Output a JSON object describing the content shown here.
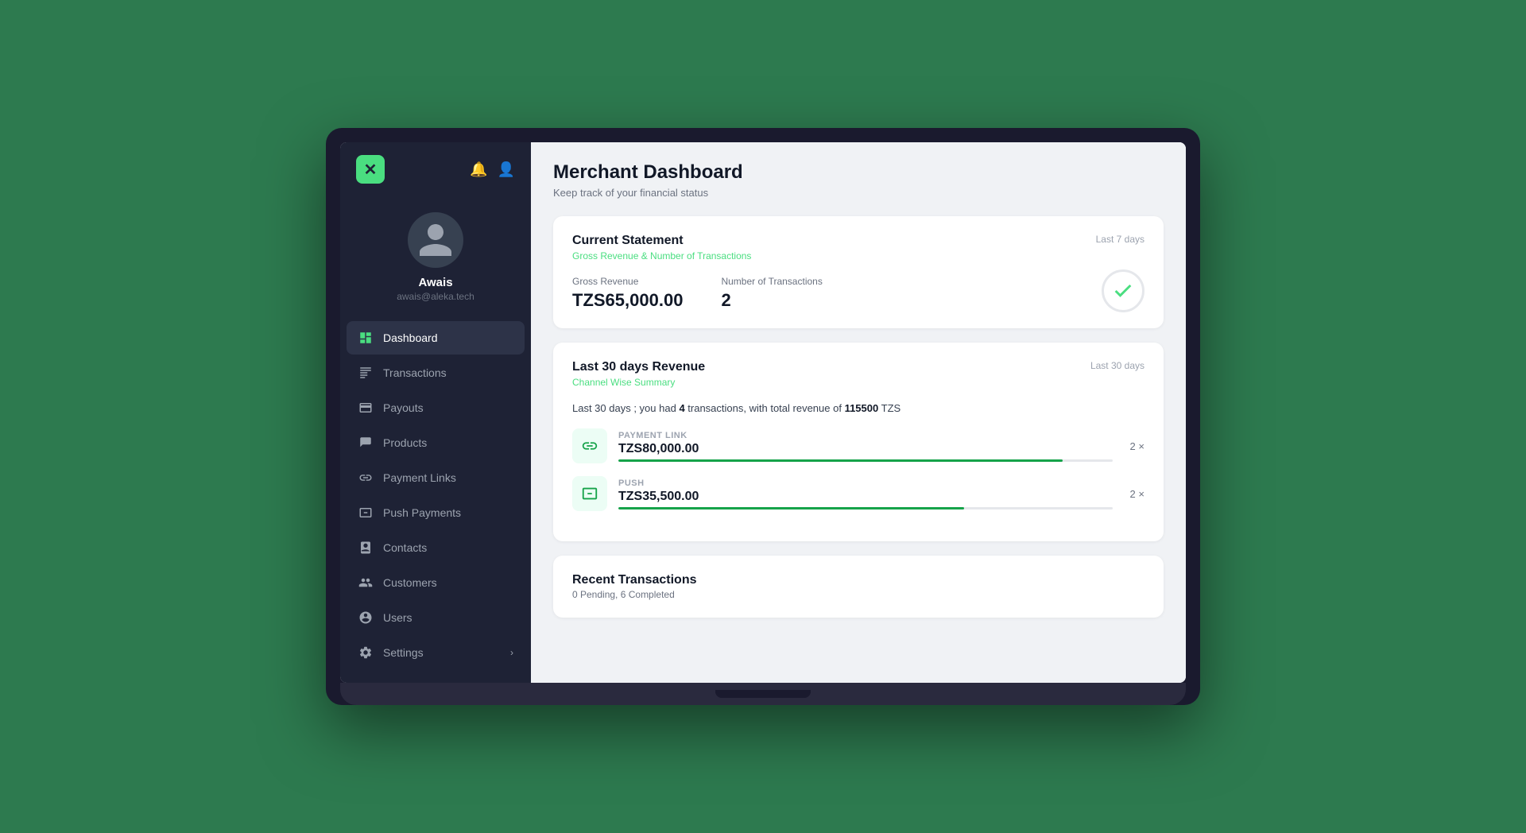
{
  "app": {
    "logo": "✕",
    "notification_icon": "🔔",
    "user_icon": "👤"
  },
  "user": {
    "name": "Awais",
    "email": "awais@aleka.tech"
  },
  "nav": {
    "items": [
      {
        "id": "dashboard",
        "label": "Dashboard",
        "icon": "dashboard",
        "active": true
      },
      {
        "id": "transactions",
        "label": "Transactions",
        "icon": "transactions",
        "active": false
      },
      {
        "id": "payouts",
        "label": "Payouts",
        "icon": "payouts",
        "active": false
      },
      {
        "id": "products",
        "label": "Products",
        "icon": "products",
        "active": false
      },
      {
        "id": "payment-links",
        "label": "Payment Links",
        "icon": "payment-links",
        "active": false
      },
      {
        "id": "push-payments",
        "label": "Push Payments",
        "icon": "push-payments",
        "active": false
      },
      {
        "id": "contacts",
        "label": "Contacts",
        "icon": "contacts",
        "active": false
      },
      {
        "id": "customers",
        "label": "Customers",
        "icon": "customers",
        "active": false
      },
      {
        "id": "users",
        "label": "Users",
        "icon": "users",
        "active": false
      },
      {
        "id": "settings",
        "label": "Settings",
        "icon": "settings",
        "active": false,
        "has_arrow": true
      }
    ]
  },
  "page": {
    "title": "Merchant Dashboard",
    "subtitle": "Keep track of your financial status"
  },
  "current_statement": {
    "title": "Current Statement",
    "subtitle": "Gross Revenue & Number of Transactions",
    "badge": "Last 7 days",
    "gross_revenue_label": "Gross Revenue",
    "gross_revenue_value": "TZS65,000.00",
    "transactions_label": "Number of Transactions",
    "transactions_value": "2"
  },
  "last30": {
    "title": "Last 30 days Revenue",
    "subtitle": "Channel Wise Summary",
    "badge": "Last 30 days",
    "summary_text_prefix": "Last 30 days ; you had ",
    "transactions_count": "4",
    "summary_text_middle": " transactions, with total revenue of ",
    "total_revenue": "115500",
    "currency": "TZS",
    "channels": [
      {
        "label": "PAYMENT LINK",
        "amount": "TZS80,000.00",
        "bar_percent": 90,
        "count": "2",
        "count_suffix": "×"
      },
      {
        "label": "PUSH",
        "amount": "TZS35,500.00",
        "bar_percent": 70,
        "count": "2",
        "count_suffix": "×"
      }
    ]
  },
  "recent_transactions": {
    "title": "Recent Transactions",
    "subtitle": "0 Pending, 6 Completed"
  }
}
